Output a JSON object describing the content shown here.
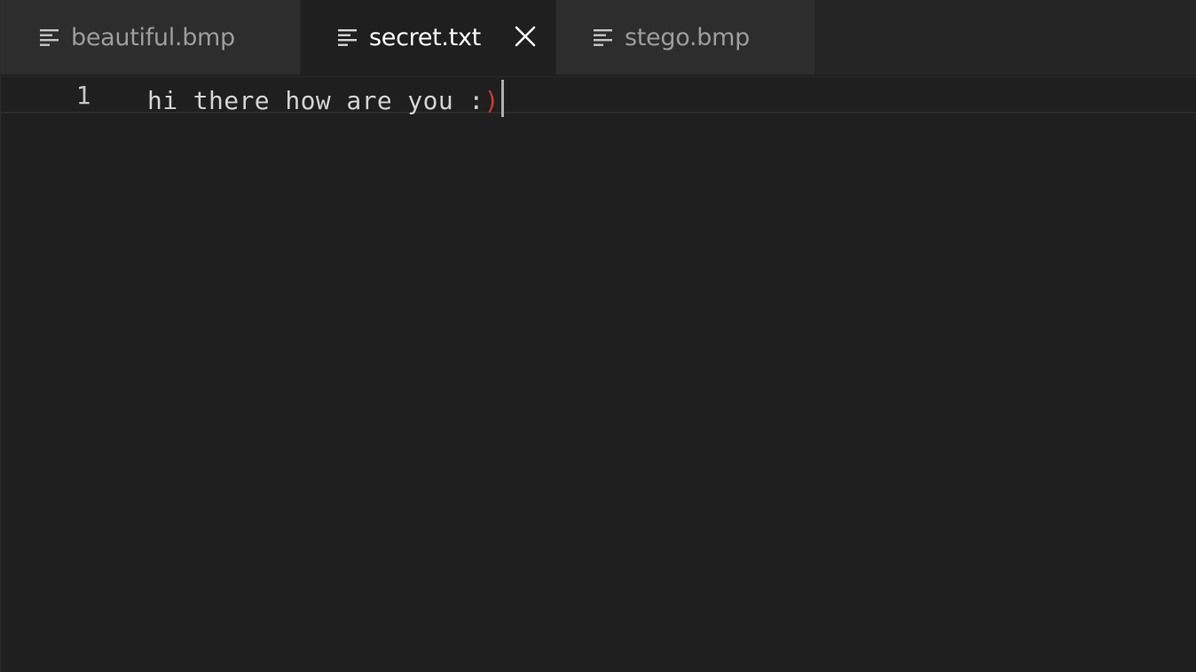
{
  "tabs": [
    {
      "label": "beautiful.bmp",
      "active": false,
      "icon": "file-lines-icon"
    },
    {
      "label": "secret.txt",
      "active": true,
      "icon": "file-lines-icon",
      "close_icon": "close-icon"
    },
    {
      "label": "stego.bmp",
      "active": false,
      "icon": "file-lines-icon"
    }
  ],
  "editor": {
    "line_number": "1",
    "line_text": "hi there how are you :",
    "line_bracket": ")"
  },
  "colors": {
    "background": "#1f1f1f",
    "tab_inactive": "#2d2d2d",
    "tab_active_text": "#ffffff",
    "tab_inactive_text": "#9d9d9d",
    "bracket": "#d0392f"
  }
}
